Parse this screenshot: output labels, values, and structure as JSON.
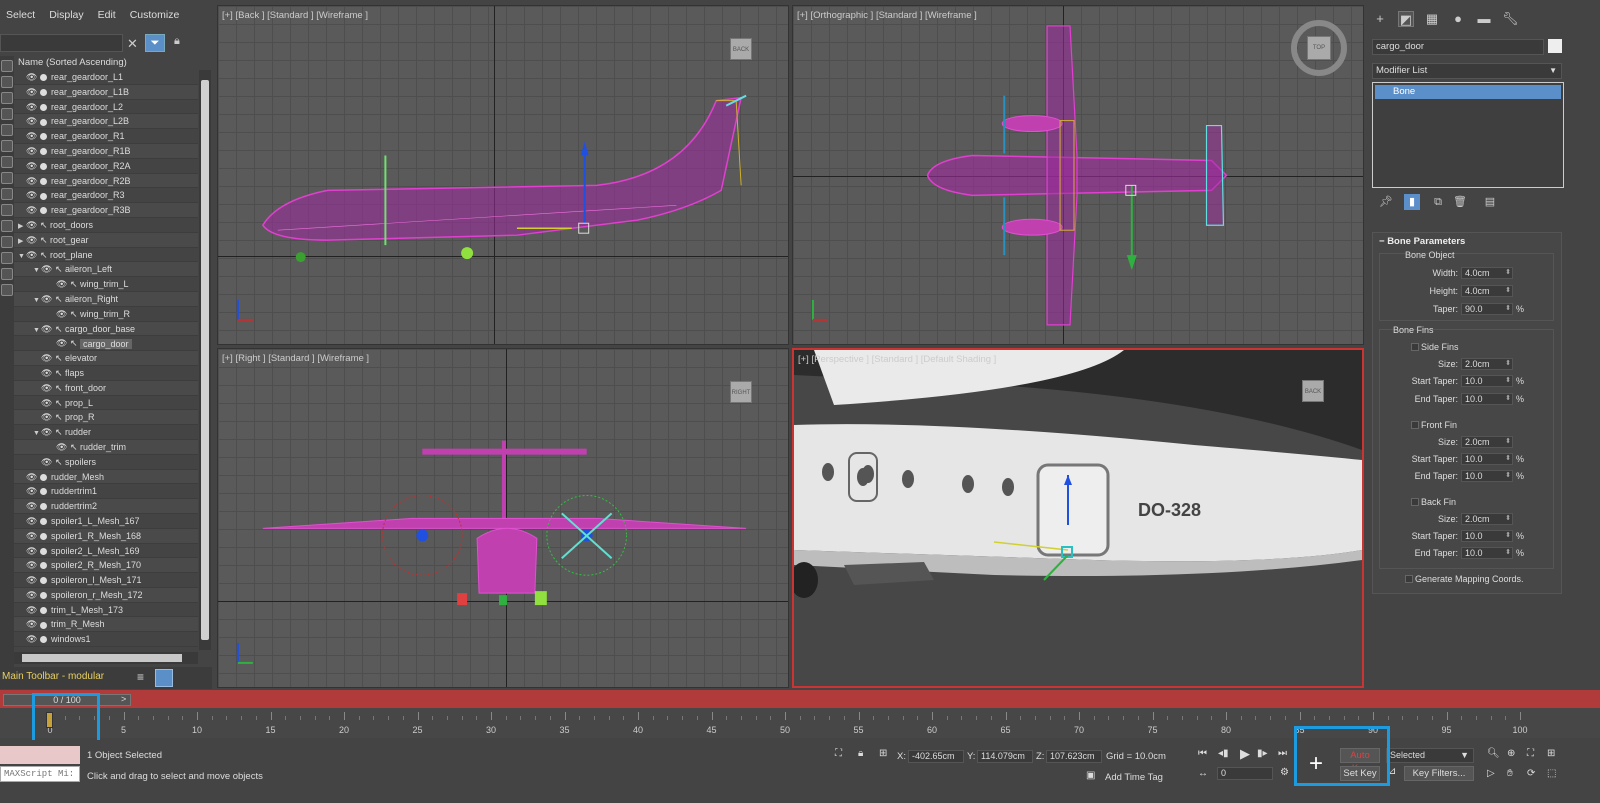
{
  "menu": [
    "Select",
    "Display",
    "Edit",
    "Customize"
  ],
  "scene_explorer": {
    "header": "Name (Sorted Ascending)",
    "rows": [
      {
        "name": "rear_geardoor_L1",
        "indent": 0,
        "type": "mesh"
      },
      {
        "name": "rear_geardoor_L1B",
        "indent": 0,
        "type": "mesh"
      },
      {
        "name": "rear_geardoor_L2",
        "indent": 0,
        "type": "mesh"
      },
      {
        "name": "rear_geardoor_L2B",
        "indent": 0,
        "type": "mesh"
      },
      {
        "name": "rear_geardoor_R1",
        "indent": 0,
        "type": "mesh"
      },
      {
        "name": "rear_geardoor_R1B",
        "indent": 0,
        "type": "mesh"
      },
      {
        "name": "rear_geardoor_R2A",
        "indent": 0,
        "type": "mesh"
      },
      {
        "name": "rear_geardoor_R2B",
        "indent": 0,
        "type": "mesh"
      },
      {
        "name": "rear_geardoor_R3",
        "indent": 0,
        "type": "mesh"
      },
      {
        "name": "rear_geardoor_R3B",
        "indent": 0,
        "type": "mesh"
      },
      {
        "name": "root_doors",
        "indent": 0,
        "type": "bone",
        "expander": "collapsed"
      },
      {
        "name": "root_gear",
        "indent": 0,
        "type": "bone",
        "expander": "collapsed"
      },
      {
        "name": "root_plane",
        "indent": 0,
        "type": "bone",
        "expander": "expanded"
      },
      {
        "name": "aileron_Left",
        "indent": 1,
        "type": "bone",
        "expander": "expanded"
      },
      {
        "name": "wing_trim_L",
        "indent": 2,
        "type": "bone"
      },
      {
        "name": "aileron_Right",
        "indent": 1,
        "type": "bone",
        "expander": "expanded"
      },
      {
        "name": "wing_trim_R",
        "indent": 2,
        "type": "bone"
      },
      {
        "name": "cargo_door_base",
        "indent": 1,
        "type": "bone",
        "expander": "expanded"
      },
      {
        "name": "cargo_door",
        "indent": 2,
        "type": "bone",
        "selected": true
      },
      {
        "name": "elevator",
        "indent": 1,
        "type": "bone"
      },
      {
        "name": "flaps",
        "indent": 1,
        "type": "bone"
      },
      {
        "name": "front_door",
        "indent": 1,
        "type": "bone"
      },
      {
        "name": "prop_L",
        "indent": 1,
        "type": "bone"
      },
      {
        "name": "prop_R",
        "indent": 1,
        "type": "bone"
      },
      {
        "name": "rudder",
        "indent": 1,
        "type": "bone",
        "expander": "expanded"
      },
      {
        "name": "rudder_trim",
        "indent": 2,
        "type": "bone"
      },
      {
        "name": "spoilers",
        "indent": 1,
        "type": "bone"
      },
      {
        "name": "rudder_Mesh",
        "indent": 0,
        "type": "mesh"
      },
      {
        "name": "ruddertrim1",
        "indent": 0,
        "type": "mesh"
      },
      {
        "name": "ruddertrim2",
        "indent": 0,
        "type": "mesh"
      },
      {
        "name": "spoiler1_L_Mesh_167",
        "indent": 0,
        "type": "mesh"
      },
      {
        "name": "spoiler1_R_Mesh_168",
        "indent": 0,
        "type": "mesh"
      },
      {
        "name": "spoiler2_L_Mesh_169",
        "indent": 0,
        "type": "mesh"
      },
      {
        "name": "spoiler2_R_Mesh_170",
        "indent": 0,
        "type": "mesh"
      },
      {
        "name": "spoileron_l_Mesh_171",
        "indent": 0,
        "type": "mesh"
      },
      {
        "name": "spoileron_r_Mesh_172",
        "indent": 0,
        "type": "mesh"
      },
      {
        "name": "trim_L_Mesh_173",
        "indent": 0,
        "type": "mesh"
      },
      {
        "name": "trim_R_Mesh",
        "indent": 0,
        "type": "mesh"
      },
      {
        "name": "windows1",
        "indent": 0,
        "type": "mesh"
      }
    ]
  },
  "toolbar_label": "Main Toolbar - modular",
  "viewports": {
    "back": "[+] [Back ] [Standard ] [Wireframe ]",
    "top": "[+] [Orthographic ] [Standard ] [Wireframe ]",
    "right": "[+] [Right ] [Standard ] [Wireframe ]",
    "persp": "[+] [Perspective ] [Standard ] [Default Shading ]",
    "aircraft_registration": "DO-328"
  },
  "command_panel": {
    "object_name": "cargo_door",
    "modifier_list": "Modifier List",
    "stack_item": "Bone",
    "rollout_title": "Bone Parameters",
    "bone_object": {
      "label": "Bone Object",
      "width_label": "Width:",
      "width": "4.0cm",
      "height_label": "Height:",
      "height": "4.0cm",
      "taper_label": "Taper:",
      "taper": "90.0"
    },
    "bone_fins": {
      "label": "Bone Fins",
      "side_fins": "Side Fins",
      "front_fin": "Front Fin",
      "back_fin": "Back Fin",
      "size_label": "Size:",
      "start_taper_label": "Start Taper:",
      "end_taper_label": "End Taper:",
      "size": "2.0cm",
      "start_taper": "10.0",
      "end_taper": "10.0",
      "pct": "%"
    },
    "gen_mapping": "Generate Mapping Coords."
  },
  "timeline": {
    "slider_value": "0 / 100",
    "ticks": [
      "0",
      "5",
      "10",
      "15",
      "20",
      "25",
      "30",
      "35",
      "40",
      "45",
      "50",
      "55",
      "60",
      "65",
      "70",
      "75",
      "80",
      "85",
      "90",
      "95",
      "100"
    ]
  },
  "status": {
    "maxscript": "MAXScript Mi:",
    "selection": "1 Object Selected",
    "prompt": "Click and drag to select and move objects",
    "x_label": "X:",
    "x": "-402.65cm",
    "y_label": "Y:",
    "y": "114.079cm",
    "z_label": "Z:",
    "z": "107.623cm",
    "grid": "Grid = 10.0cm",
    "add_time_tag": "Add Time Tag",
    "auto_key": "Auto Key",
    "set_key": "Set Key",
    "selected": "Selected",
    "key_filters": "Key Filters...",
    "frame": "0"
  },
  "colors": {
    "accent": "#1d9be0",
    "wire": "#c030b0",
    "timeline": "#b13a3a",
    "selection": "#5b8fca"
  }
}
